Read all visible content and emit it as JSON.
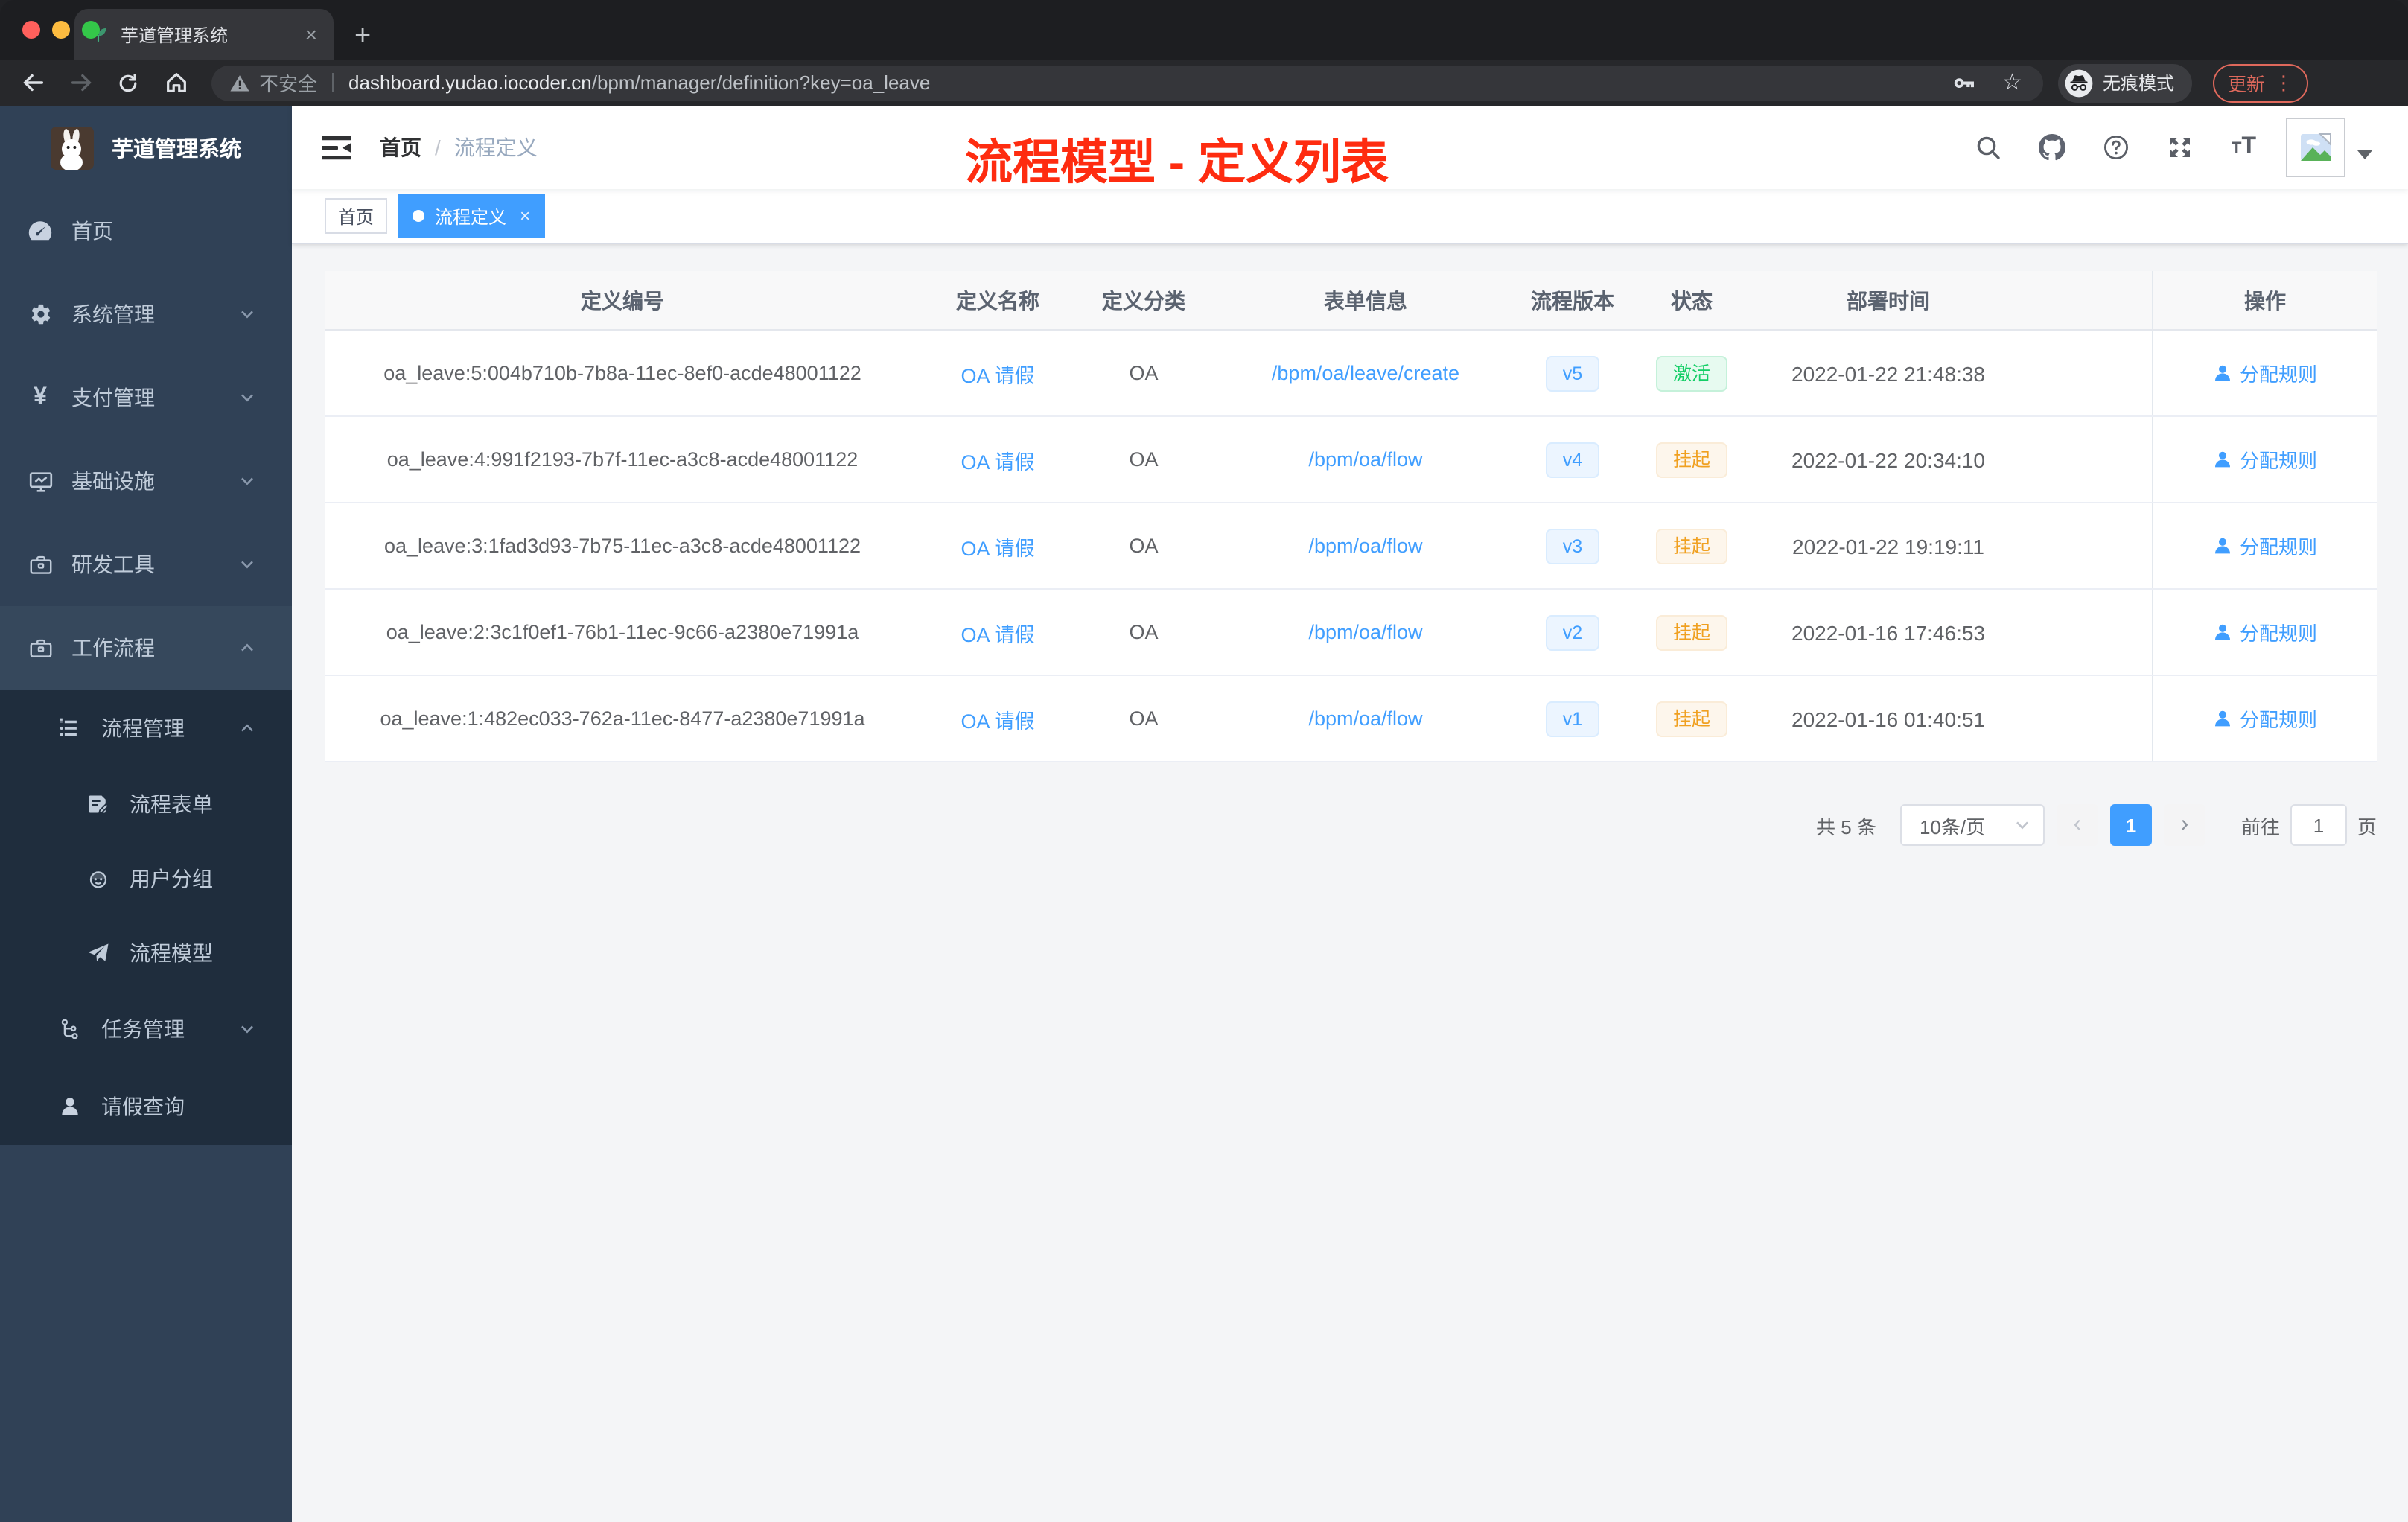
{
  "browser": {
    "tab_title": "芋道管理系统",
    "close_glyph": "×",
    "plus_glyph": "+",
    "security_label": "不安全",
    "url_domain": "dashboard.yudao.iocoder.cn",
    "url_path": "/bpm/manager/definition?key=oa_leave",
    "star_glyph": "☆",
    "incognito_label": "无痕模式",
    "update_label": "更新",
    "kebab_glyph": "⋮"
  },
  "sidebar": {
    "app_title": "芋道管理系统",
    "menu": [
      {
        "label": "首页",
        "icon": "dashboard-icon"
      },
      {
        "label": "系统管理",
        "icon": "gear-icon"
      },
      {
        "label": "支付管理",
        "icon": "yen-icon"
      },
      {
        "label": "基础设施",
        "icon": "monitor-icon"
      },
      {
        "label": "研发工具",
        "icon": "toolbox-icon"
      },
      {
        "label": "工作流程",
        "icon": "briefcase-icon"
      },
      {
        "label": "流程管理",
        "icon": "list-icon"
      },
      {
        "label": "流程表单",
        "icon": "form-icon"
      },
      {
        "label": "用户分组",
        "icon": "robot-icon"
      },
      {
        "label": "流程模型",
        "icon": "paper-plane-icon"
      },
      {
        "label": "任务管理",
        "icon": "flow-icon"
      },
      {
        "label": "请假查询",
        "icon": "user-icon"
      }
    ]
  },
  "navbar": {
    "breadcrumb_home": "首页",
    "breadcrumb_sep": "/",
    "breadcrumb_current": "流程定义"
  },
  "annotation": {
    "text": "流程模型 - 定义列表",
    "color": "#fe2c10"
  },
  "tags": {
    "items": [
      {
        "label": "首页"
      },
      {
        "label": "流程定义"
      }
    ]
  },
  "table": {
    "columns": [
      "定义编号",
      "定义名称",
      "定义分类",
      "表单信息",
      "流程版本",
      "状态",
      "部署时间",
      "操作"
    ],
    "rows": [
      {
        "id": "oa_leave:5:004b710b-7b8a-11ec-8ef0-acde48001122",
        "name": "OA 请假",
        "category": "OA",
        "form": "/bpm/oa/leave/create",
        "version": "v5",
        "status": "激活",
        "status_type": "success",
        "time": "2022-01-22 21:48:38",
        "action": "分配规则"
      },
      {
        "id": "oa_leave:4:991f2193-7b7f-11ec-a3c8-acde48001122",
        "name": "OA 请假",
        "category": "OA",
        "form": "/bpm/oa/flow",
        "version": "v4",
        "status": "挂起",
        "status_type": "warning",
        "time": "2022-01-22 20:34:10",
        "action": "分配规则"
      },
      {
        "id": "oa_leave:3:1fad3d93-7b75-11ec-a3c8-acde48001122",
        "name": "OA 请假",
        "category": "OA",
        "form": "/bpm/oa/flow",
        "version": "v3",
        "status": "挂起",
        "status_type": "warning",
        "time": "2022-01-22 19:19:11",
        "action": "分配规则"
      },
      {
        "id": "oa_leave:2:3c1f0ef1-76b1-11ec-9c66-a2380e71991a",
        "name": "OA 请假",
        "category": "OA",
        "form": "/bpm/oa/flow",
        "version": "v2",
        "status": "挂起",
        "status_type": "warning",
        "time": "2022-01-16 17:46:53",
        "action": "分配规则"
      },
      {
        "id": "oa_leave:1:482ec033-762a-11ec-8477-a2380e71991a",
        "name": "OA 请假",
        "category": "OA",
        "form": "/bpm/oa/flow",
        "version": "v1",
        "status": "挂起",
        "status_type": "warning",
        "time": "2022-01-16 01:40:51",
        "action": "分配规则"
      }
    ]
  },
  "pagination": {
    "total": "共 5 条",
    "page_size": "10条/页",
    "prev_glyph": "‹",
    "current_page": "1",
    "next_glyph": "›",
    "goto_label": "前往",
    "goto_value": "1",
    "page_unit": "页"
  },
  "colors": {
    "accent": "#409eff",
    "sidebar_bg": "#304156",
    "submenu_bg": "#1f2d3d",
    "annotation_red": "#fe2c10",
    "status_active_text": "#13ce66",
    "status_suspend_text": "#f0a020",
    "version_text": "#409eff"
  }
}
